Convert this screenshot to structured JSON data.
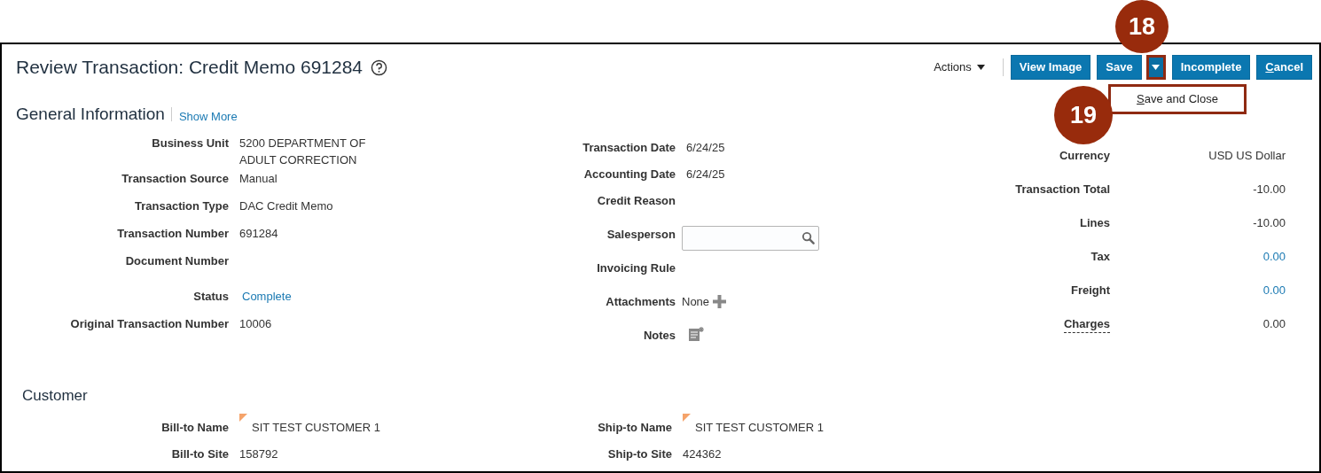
{
  "page": {
    "title": "Review Transaction: Credit Memo 691284"
  },
  "toolbar": {
    "actions": "Actions",
    "buttons": [
      {
        "label": "View Image",
        "kind": "button"
      },
      {
        "label": "Save",
        "kind": "button"
      },
      {
        "kind": "split-arrow",
        "expanded": true
      },
      {
        "label": "Incomplete",
        "kind": "button"
      },
      {
        "label": "Cancel",
        "kind": "button"
      }
    ],
    "menu": [
      "Save and Close"
    ]
  },
  "callouts": [
    "18",
    "19"
  ],
  "general_information": {
    "title": "General Information",
    "link": "Show More",
    "column_1": [
      {
        "label": "Business Unit",
        "value": "5200 DEPARTMENT OF ADULT CORRECTION",
        "kind": "text"
      },
      {
        "label": "Transaction Source",
        "value": "Manual",
        "kind": "text"
      },
      {
        "label": "Transaction Type",
        "value": "DAC Credit Memo",
        "kind": "text"
      },
      {
        "label": "Transaction Number",
        "value": "691284",
        "kind": "text"
      },
      {
        "label": "Document Number",
        "kind": "empty"
      },
      {
        "label": "Status",
        "value": "Complete",
        "kind": "link"
      },
      {
        "label": "Original Transaction Number",
        "value": "10006",
        "kind": "text"
      }
    ],
    "column_2": [
      {
        "label": "Transaction Date",
        "value": "6/24/25",
        "kind": "text"
      },
      {
        "label": "Accounting Date",
        "value": "6/24/25",
        "kind": "text"
      },
      {
        "label": "Credit Reason",
        "kind": "empty"
      },
      {
        "label": "Salesperson",
        "kind": "search-field"
      },
      {
        "label": "Invoicing Rule",
        "kind": "empty"
      },
      {
        "label": "Attachments",
        "value": "None",
        "kind": "attachments"
      },
      {
        "label": "Notes",
        "kind": "notes"
      }
    ],
    "column_3": [
      {
        "label": "Currency",
        "value": "USD US Dollar",
        "kind": "text",
        "label_link": false
      },
      {
        "label": "Transaction Total",
        "value": "-10.00",
        "kind": "text",
        "label_link": false
      },
      {
        "label": "Lines",
        "value": "-10.00",
        "kind": "text",
        "label_link": false
      },
      {
        "label": "Tax",
        "value": "0.00",
        "kind": "link",
        "label_link": false
      },
      {
        "label": "Freight",
        "value": "0.00",
        "kind": "link",
        "label_link": false
      },
      {
        "label": "Charges",
        "value": "0.00",
        "kind": "text",
        "label_link": true
      }
    ]
  },
  "customer": {
    "title": "Customer",
    "column_1": [
      {
        "label": "Bill-to Name",
        "value": "SIT TEST CUSTOMER 1",
        "kind": "flagged"
      },
      {
        "label": "Bill-to Site",
        "value": "158792",
        "kind": "text"
      }
    ],
    "column_2": [
      {
        "label": "Ship-to Name",
        "value": "SIT TEST CUSTOMER 1",
        "kind": "flagged"
      },
      {
        "label": "Ship-to Site",
        "value": "424362",
        "kind": "text"
      }
    ]
  }
}
